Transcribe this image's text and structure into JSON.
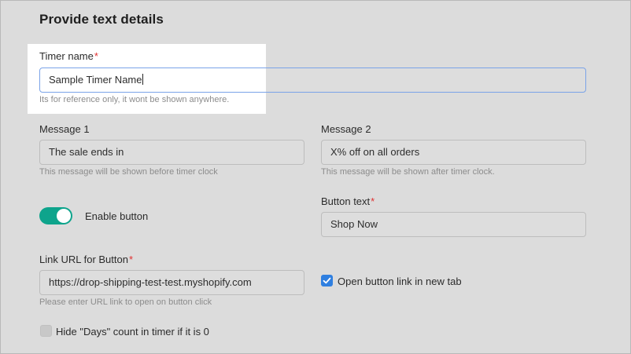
{
  "section": {
    "title": "Provide text details"
  },
  "timer_name": {
    "label": "Timer name",
    "required_mark": "*",
    "value": "Sample Timer Name",
    "help": "Its for reference only, it wont be shown anywhere."
  },
  "message1": {
    "label": "Message 1",
    "value": "The sale ends in",
    "help": "This message will be shown before timer clock"
  },
  "message2": {
    "label": "Message 2",
    "value": "X% off on all orders",
    "help": "This message will be shown after timer clock."
  },
  "enable_button": {
    "label": "Enable button",
    "on": true,
    "accent": "#0ea48c"
  },
  "button_text": {
    "label": "Button text",
    "required_mark": "*",
    "value": "Shop Now"
  },
  "link_url": {
    "label": "Link URL for Button",
    "required_mark": "*",
    "value": "https://drop-shipping-test-test.myshopify.com",
    "help": "Please enter URL link to open on button click"
  },
  "open_new_tab": {
    "label": "Open button link in new tab",
    "checked": true,
    "accent": "#2f7fe0"
  },
  "hide_days": {
    "label": "Hide \"Days\" count in timer if it is 0",
    "checked": false
  }
}
